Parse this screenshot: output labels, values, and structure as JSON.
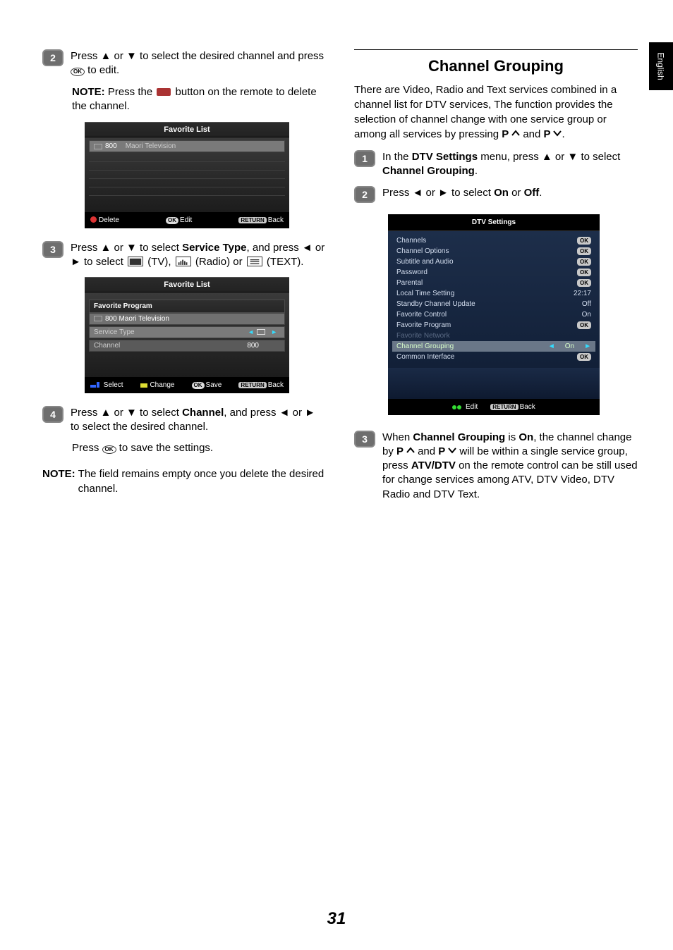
{
  "page_number": "31",
  "language_tab": "English",
  "left": {
    "step2": {
      "num": "2",
      "t1": "Press ▲ or ▼ to select the desired channel and press ",
      "t2": " to edit.",
      "ok": "OK"
    },
    "note1": {
      "label": "NOTE:",
      "t1": " Press the ",
      "t2": " button on the remote to delete the channel."
    },
    "panel1": {
      "title": "Favorite List",
      "row_num": "800",
      "row_name": "Maori Television",
      "delete": "Delete",
      "edit_pill": "OK",
      "edit": "Edit",
      "return_pill": "RETURN",
      "back": "Back"
    },
    "step3": {
      "num": "3",
      "t1": "Press ▲ or ▼ to select ",
      "bold1": "Service Type",
      "t2": ", and press ◄ or ► to select ",
      "tv": " (TV), ",
      "radio": " (Radio) or ",
      "text": " (TEXT)."
    },
    "panel2": {
      "title": "Favorite List",
      "sub": "Favorite Program",
      "row0_name": "800 Maori Television",
      "row1_label": "Service Type",
      "row2_label": "Channel",
      "row2_val": "800",
      "select": "Select",
      "change": "Change",
      "save_pill": "OK",
      "save": "Save",
      "return_pill": "RETURN",
      "back": "Back"
    },
    "step4": {
      "num": "4",
      "t1": "Press ▲ or ▼ to select ",
      "bold1": "Channel",
      "t2": ", and press ◄ or ► to select the desired channel."
    },
    "step4b": {
      "t1": "Press ",
      "ok": "OK",
      "t2": " to save the settings."
    },
    "note2": {
      "label": "NOTE:",
      "text": " The field remains empty once you delete the desired channel."
    }
  },
  "right": {
    "section_title": "Channel Grouping",
    "intro_a": "There are Video, Radio and Text services combined in a channel list for DTV services, The function provides the selection of channel change with one service group or among all services by pressing ",
    "p_up": "P ",
    "and": " and ",
    "p_dn": "P ",
    "intro_b": ".",
    "step1": {
      "num": "1",
      "t1": "In the ",
      "bold1": "DTV Settings",
      "t2": " menu, press ▲ or ▼ to select ",
      "bold2": "Channel Grouping",
      "t3": "."
    },
    "step2": {
      "num": "2",
      "t1": "Press ◄ or ► to select ",
      "bold1": "On",
      "t2": " or ",
      "bold2": "Off",
      "t3": "."
    },
    "dtv": {
      "title": "DTV Settings",
      "rows": [
        {
          "label": "Channels",
          "val": "OK",
          "box": true
        },
        {
          "label": "Channel Options",
          "val": "OK",
          "box": true
        },
        {
          "label": "Subtitle and Audio",
          "val": "OK",
          "box": true
        },
        {
          "label": "Password",
          "val": "OK",
          "box": true
        },
        {
          "label": "Parental",
          "val": "OK",
          "box": true
        },
        {
          "label": "Local Time Setting",
          "val": "22:17",
          "box": false
        },
        {
          "label": "Standby Channel Update",
          "val": "Off",
          "box": false
        },
        {
          "label": "Favorite Control",
          "val": "On",
          "box": false
        },
        {
          "label": "Favorite Program",
          "val": "OK",
          "box": true
        },
        {
          "label": "Favorite Network",
          "val": "",
          "box": false,
          "dim": true
        },
        {
          "label": "Channel Grouping",
          "val": "On",
          "box": false,
          "sel": true
        },
        {
          "label": "Common Interface",
          "val": "OK",
          "box": true
        }
      ],
      "edit": "Edit",
      "return": "RETURN",
      "back": "Back"
    },
    "step3": {
      "num": "3",
      "t1": "When ",
      "bold1": "Channel Grouping",
      "t2": " is ",
      "bold2": "On",
      "t3": ", the channel change by ",
      "t4": " will be within a single service group, press ",
      "bold3": "ATV/DTV",
      "t5": " on the remote control can be still used for change services among ATV, DTV Video, DTV Radio and DTV Text."
    }
  }
}
